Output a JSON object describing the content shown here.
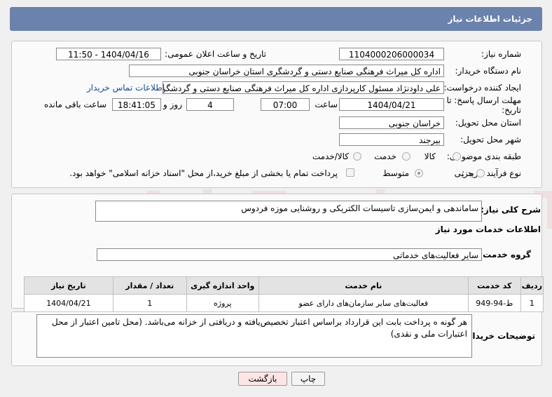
{
  "header": {
    "title": "جزئیات اطلاعات نیاز"
  },
  "form": {
    "need_number_label": "شماره نیاز:",
    "need_number": "1104000206000034",
    "announce_label": "تاریخ و ساعت اعلان عمومی:",
    "announce_value": "1404/04/16 - 11:50",
    "buyer_org_label": "نام دستگاه خریدار:",
    "buyer_org": "اداره کل میراث فرهنگی  صنایع دستی و گردشگری استان خراسان جنوبی",
    "creator_label": "ایجاد کننده درخواست:",
    "creator": "علی داودنژاد مسئول کارپردازی اداره کل میراث فرهنگی  صنایع دستی و گردشگری استان خراسان جنوبی",
    "contact_link": "اطلاعات تماس خریدار",
    "deadline_label_1": "مهلت ارسال پاسخ: تا",
    "deadline_label_2": "تاریخ:",
    "deadline_date": "1404/04/21",
    "time_label": "ساعت",
    "deadline_time": "07:00",
    "days_value": "4",
    "days_label": "روز و",
    "remaining_time": "18:41:05",
    "remaining_label": "ساعت باقی مانده",
    "province_label": "استان محل تحویل:",
    "province": "خراسان جنوبی",
    "city_label": "شهر محل تحویل:",
    "city": "بیرجند",
    "category_label": "طبقه بندی موضوعی:",
    "category_options": [
      "کالا",
      "خدمت",
      "کالا/خدمت"
    ],
    "process_label": "نوع فرآیند خرید :",
    "process_options": [
      "جزیی",
      "متوسط"
    ],
    "payment_note": "پرداخت تمام یا بخشی از مبلغ خرید،از محل \"اسناد خزانه اسلامی\" خواهد بود."
  },
  "summary": {
    "label": "شرح کلی نیاز:",
    "value": "ساماندهی و ایمن‌سازی تاسیسات الکتریکی و روشنایی موزه فردوس"
  },
  "services": {
    "section_title": "اطلاعات خدمات مورد نیاز",
    "group_label": "گروه خدمت:",
    "group_value": "سایر فعالیت‌های خدماتی",
    "columns": [
      "ردیف",
      "کد خدمت",
      "نام خدمت",
      "واحد اندازه گیری",
      "تعداد / مقدار",
      "تاریخ نیاز"
    ],
    "rows": [
      [
        "1",
        "ط-94-949",
        "فعالیت‌های سایر سازمان‌های دارای عضو",
        "پروژه",
        "1",
        "1404/04/21"
      ]
    ]
  },
  "buyer_notes": {
    "label": "توضیحات خریدار:",
    "value": "هر گونه ه پرداخت بابت این قرارداد براساس اعتبار تخصیص‌یافته و دریافتی از خزانه می‌باشد. (محل تامین اعتبار از محل اعتبارات ملی و نقدی)"
  },
  "buttons": {
    "print": "چاپ",
    "back": "بازگشت"
  },
  "watermark": "AriaTender.neT",
  "colors": {
    "header_bg": "#6b82ad",
    "back_button_bg": "#fde5e5",
    "link": "#1a4a9a"
  }
}
